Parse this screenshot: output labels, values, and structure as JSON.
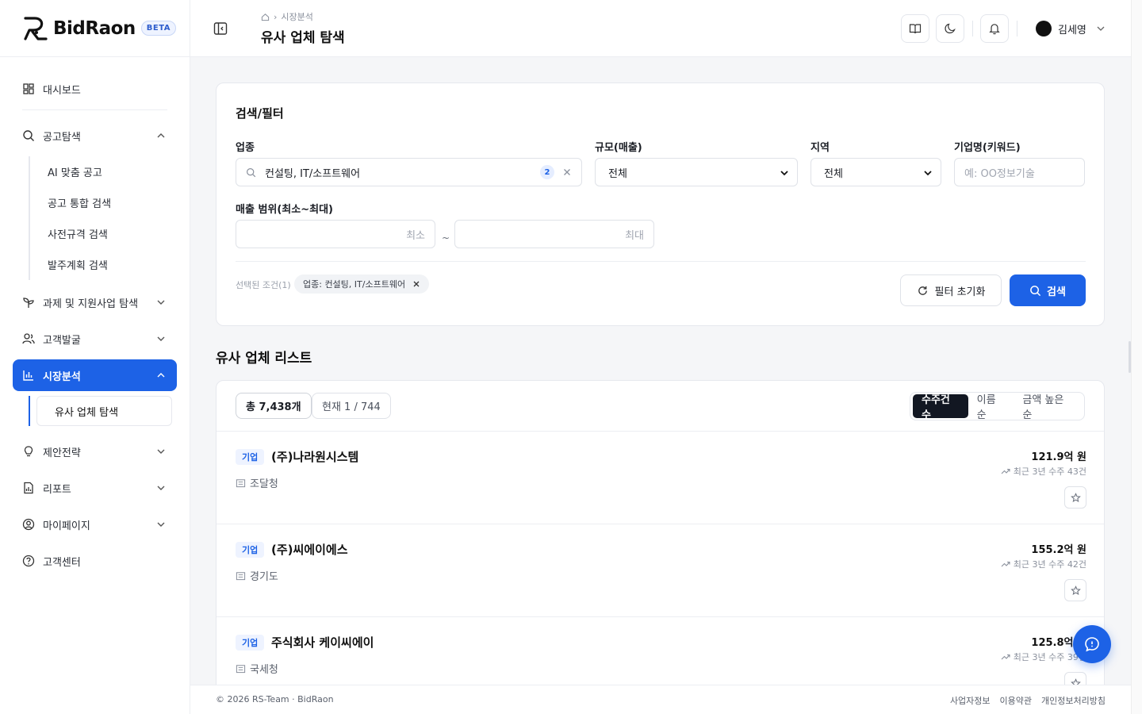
{
  "brand": {
    "name": "BidRaon",
    "beta": "BETA"
  },
  "sidebar": {
    "items": [
      {
        "label": "대시보드"
      },
      {
        "label": "공고탐색",
        "subitems": [
          "AI 맞춤 공고",
          "공고 통합 검색",
          "사전규격 검색",
          "발주계획 검색"
        ]
      },
      {
        "label": "과제 및 지원사업 탐색"
      },
      {
        "label": "고객발굴"
      },
      {
        "label": "시장분석",
        "subitems": [
          "유사 업체 탐색"
        ]
      },
      {
        "label": "제안전략"
      },
      {
        "label": "리포트"
      },
      {
        "label": "마이페이지"
      },
      {
        "label": "고객센터"
      }
    ]
  },
  "header": {
    "breadcrumb": "시장분석",
    "title": "유사 업체 탐색",
    "user": "김세영"
  },
  "filter": {
    "title": "검색/필터",
    "industry_label": "업종",
    "industry_value": "컨설팅, IT/소프트웨어",
    "industry_count": "2",
    "scale_label": "규모(매출)",
    "scale_value": "전체",
    "region_label": "지역",
    "region_value": "전체",
    "keyword_label": "기업명(키워드)",
    "keyword_placeholder": "예: OO정보기술",
    "range_label": "매출 범위(최소~최대)",
    "min_placeholder": "최소",
    "max_placeholder": "최대",
    "range_sep": "~",
    "selected_label": "선택된 조건(1)",
    "selected_chip": "업종: 컨설팅, IT/소프트웨어",
    "reset_label": "필터 초기화",
    "search_label": "검색"
  },
  "list": {
    "title": "유사 업체 리스트",
    "total": "총 7,438개",
    "page": "현재 1 / 744",
    "sort_options": [
      "수주건수",
      "이름순",
      "금액 높은순"
    ],
    "sort_selected": "수주건수",
    "rows": [
      {
        "tag": "기업",
        "name": "(주)나라원시스템",
        "agency": "조달청",
        "amount": "121.9억 원",
        "recent": "최근 3년 수주 43건"
      },
      {
        "tag": "기업",
        "name": "(주)씨에이에스",
        "agency": "경기도",
        "amount": "155.2억 원",
        "recent": "최근 3년 수주 42건"
      },
      {
        "tag": "기업",
        "name": "주식회사 케이씨에이",
        "agency": "국세청",
        "amount": "125.8억 원",
        "recent": "최근 3년 수주 39건"
      }
    ]
  },
  "footer": {
    "copyright": "© 2026 RS-Team · BidRaon",
    "links": [
      "사업자정보",
      "이용약관",
      "개인정보처리방침"
    ]
  },
  "colors": {
    "accent": "#1d62e6",
    "dark": "#121722"
  }
}
